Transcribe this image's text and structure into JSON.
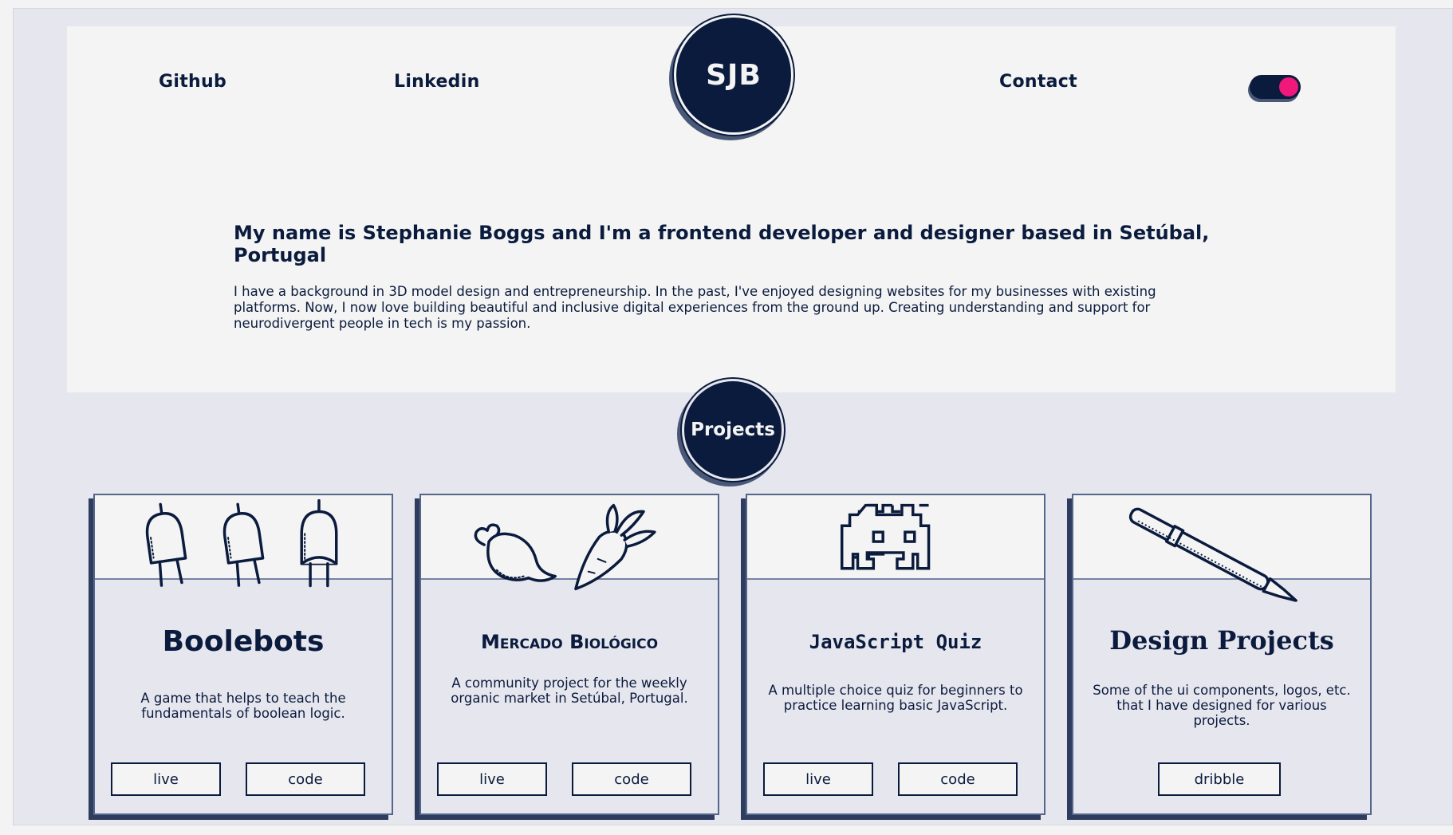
{
  "nav": {
    "github_label": "Github",
    "linkedin_label": "Linkedin",
    "contact_label": "Contact",
    "logo_text": "SJB"
  },
  "theme_toggle": {
    "state": "on",
    "knob_color": "#f0187a"
  },
  "intro": {
    "heading": "My name is Stephanie Boggs and I'm a frontend developer and designer based in Setúbal, Portugal",
    "body": "I have a background in 3D model design and entrepreneurship. In the past, I've enjoyed designing websites for my businesses with existing platforms. Now, I now love building beautiful and inclusive digital experiences from the ground up. Creating understanding and support for neurodivergent people in tech is my passion."
  },
  "projects": {
    "badge_label": "Projects",
    "cards": [
      {
        "title": "Boolebots",
        "description": "A game that helps to teach the fundamentals of boolean logic.",
        "icon": "robots-icon",
        "buttons": [
          "live",
          "code"
        ]
      },
      {
        "title": "Mercado Biológico",
        "description": "A community project for the weekly organic market in Setúbal, Portugal.",
        "icon": "vegetables-icon",
        "buttons": [
          "live",
          "code"
        ]
      },
      {
        "title": "JavaScript Quiz",
        "description": "A multiple choice quiz for beginners to practice learning basic JavaScript.",
        "icon": "space-invader-icon",
        "buttons": [
          "live",
          "code"
        ]
      },
      {
        "title": "Design Projects",
        "description": "Some of the ui components, logos, etc. that I have designed for various projects.",
        "icon": "pen-icon",
        "buttons": [
          "dribble"
        ]
      }
    ]
  },
  "colors": {
    "navy": "#0b1b3d",
    "background": "#e6e6ee",
    "panel": "#f3f4f3",
    "accent_pink": "#f0187a"
  }
}
